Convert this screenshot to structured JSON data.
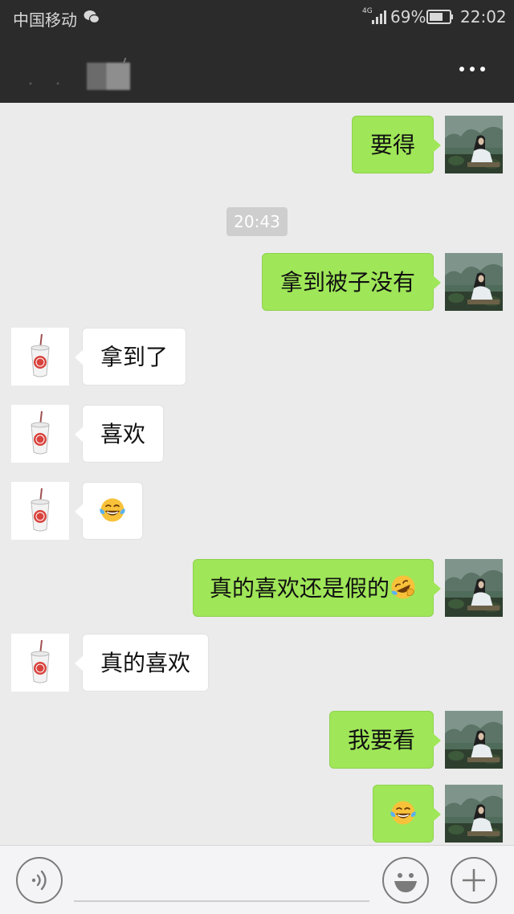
{
  "status_bar": {
    "carrier": "中国移动",
    "network": "4G",
    "battery_pct": "69%",
    "time": "22:02"
  },
  "nav": {
    "more_icon": "more-horizontal-icon"
  },
  "messages": [
    {
      "side": "self",
      "text": "要得"
    },
    {
      "side": "timestamp",
      "text": "20:43"
    },
    {
      "side": "self",
      "text": "拿到被子没有"
    },
    {
      "side": "other",
      "text": "拿到了"
    },
    {
      "side": "other",
      "text": "喜欢"
    },
    {
      "side": "other",
      "emoji": "tears-of-joy-emoji"
    },
    {
      "side": "self",
      "text": "真的喜欢还是假的",
      "emoji": "rolling-laughing-emoji"
    },
    {
      "side": "other",
      "text": "真的喜欢"
    },
    {
      "side": "self",
      "text": "我要看"
    },
    {
      "side": "self",
      "emoji": "tears-of-joy-emoji"
    }
  ],
  "input_bar": {
    "voice_icon": "voice-icon",
    "emoji_icon": "smiley-icon",
    "plus_icon": "plus-icon",
    "input_value": ""
  }
}
